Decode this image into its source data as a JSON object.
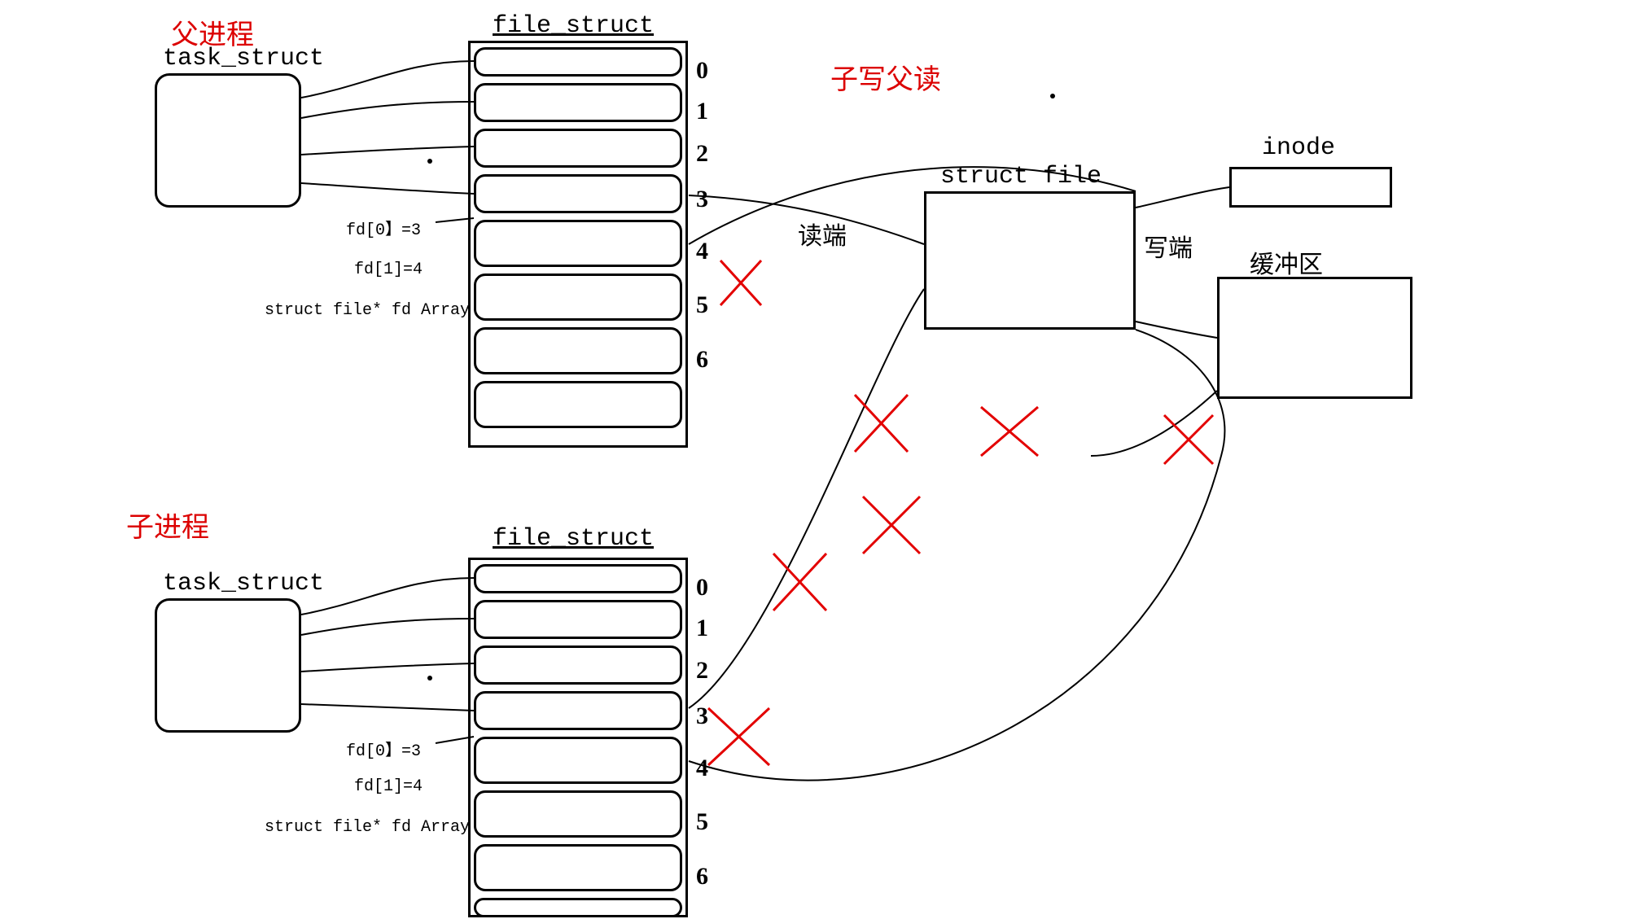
{
  "labels": {
    "parent_process": "父进程",
    "child_process": "子进程",
    "task_struct": "task_struct",
    "file_struct": "file_struct",
    "child_writes_parent_reads": "子写父读",
    "struct_file": "struct file",
    "inode": "inode",
    "buffer": "缓冲区",
    "read_end": "读端",
    "write_end": "写端",
    "fd0": "fd[0】=3",
    "fd1": "fd[1]=4",
    "fd_array": "struct file* fd Array"
  },
  "fd_indices": [
    "0",
    "1",
    "2",
    "3",
    "4",
    "5",
    "6"
  ]
}
